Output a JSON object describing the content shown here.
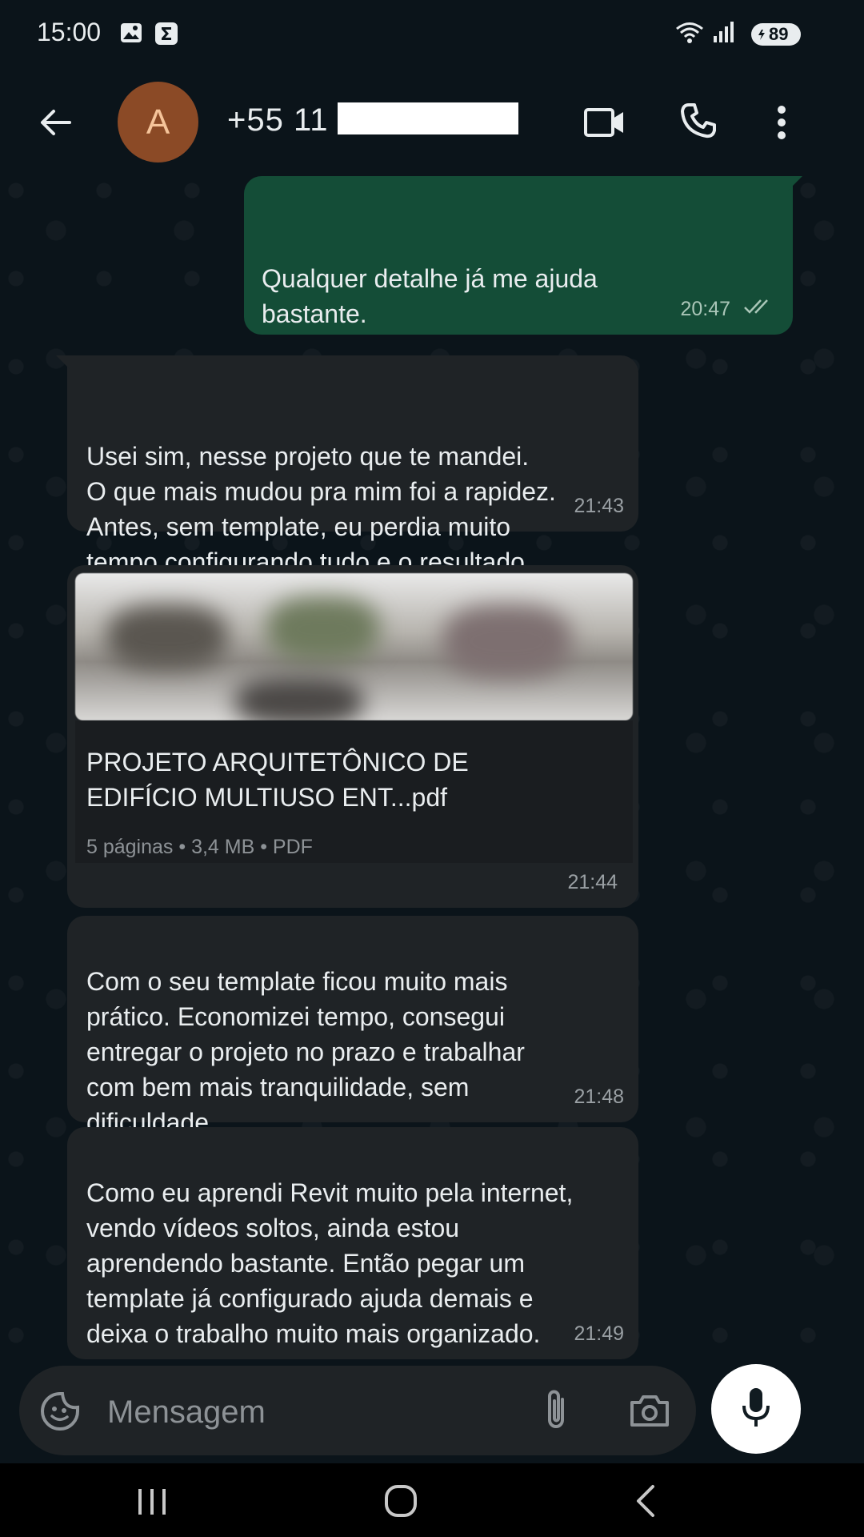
{
  "status_bar": {
    "time": "15:00",
    "battery": "89",
    "icons": [
      "gallery-icon",
      "sigma-icon",
      "wifi-icon",
      "signal-icon",
      "battery-icon"
    ]
  },
  "header": {
    "avatar_letter": "A",
    "contact_name": "+55 11",
    "icons": [
      "back-arrow-icon",
      "video-call-icon",
      "phone-icon",
      "more-vert-icon"
    ]
  },
  "messages": [
    {
      "direction": "out",
      "text": "Qualquer detalhe já me ajuda\nbastante.\n\nObrigado desde já.",
      "time": "20:47",
      "status": "read"
    },
    {
      "direction": "in",
      "text": "Usei sim, nesse projeto que te mandei.\nO que mais mudou pra mim foi a rapidez.\nAntes, sem template, eu perdia muito\ntempo configurando tudo e o resultado\nnem sempre ficava tão legal.",
      "time": "21:43"
    },
    {
      "direction": "in",
      "type": "document",
      "filename": "PROJETO ARQUITETÔNICO DE\nEDIFÍCIO MULTIUSO ENT...pdf",
      "meta": "5 páginas • 3,4 MB • PDF",
      "time": "21:44"
    },
    {
      "direction": "in",
      "text": "Com o seu template ficou muito mais\nprático. Economizei tempo, consegui\nentregar o projeto no prazo e trabalhar\ncom bem mais tranquilidade, sem\ndificuldade.",
      "time": "21:48"
    },
    {
      "direction": "in",
      "text": "Como eu aprendi Revit muito pela internet,\nvendo vídeos soltos, ainda estou\naprendendo bastante. Então pegar um\ntemplate já configurado ajuda demais e\ndeixa o trabalho muito mais organizado.",
      "time": "21:49"
    }
  ],
  "composer": {
    "placeholder": "Mensagem",
    "icons": [
      "sticker-icon",
      "attach-icon",
      "camera-icon",
      "mic-icon"
    ]
  },
  "colors": {
    "background": "#0b141a",
    "outgoing_bubble": "#144d37",
    "incoming_bubble": "#1f2326",
    "read_ticks": "#aac6b8"
  }
}
